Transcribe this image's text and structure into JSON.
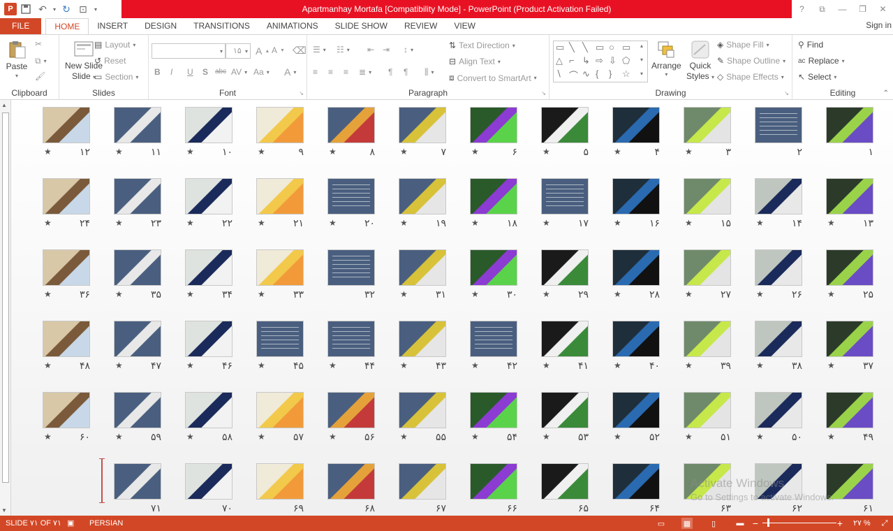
{
  "window": {
    "title": "Apartmanhay Mortafa [Compatibility Mode] -  PowerPoint (Product Activation Failed)",
    "app_icon": "P",
    "controls": [
      "?",
      "⧉",
      "—",
      "❐",
      "✕"
    ]
  },
  "qat": {
    "save_icon": "save-icon",
    "undo_icon": "undo-icon",
    "redo_icon": "redo-icon",
    "present_icon": "slideshow-icon"
  },
  "tabs": [
    "FILE",
    "HOME",
    "INSERT",
    "DESIGN",
    "TRANSITIONS",
    "ANIMATIONS",
    "SLIDE SHOW",
    "REVIEW",
    "VIEW"
  ],
  "active_tab": "HOME",
  "signin": "Sign in",
  "ribbon": {
    "clipboard": {
      "label": "Clipboard",
      "paste": "Paste"
    },
    "slides": {
      "label": "Slides",
      "new_slide": "New Slide",
      "new_slide_l2": "Slide",
      "layout": "Layout",
      "reset": "Reset",
      "section": "Section"
    },
    "font": {
      "label": "Font",
      "font_name": "",
      "font_size": "۱۵",
      "bold": "B",
      "italic": "I",
      "underline": "U",
      "shadow": "S",
      "strike": "abc",
      "spacing": "AV",
      "case": "Aa",
      "color": "A"
    },
    "paragraph": {
      "label": "Paragraph",
      "text_direction": "Text Direction",
      "align_text": "Align Text",
      "smartart": "Convert to SmartArt"
    },
    "drawing": {
      "label": "Drawing",
      "arrange": "Arrange",
      "quick": "Quick",
      "styles": "Styles",
      "shape_fill": "Shape Fill",
      "shape_outline": "Shape Outline",
      "shape_effects": "Shape Effects"
    },
    "editing": {
      "label": "Editing",
      "find": "Find",
      "replace": "Replace",
      "select": "Select"
    }
  },
  "slides": [
    {
      "n": "۱",
      "star": false
    },
    {
      "n": "۲",
      "star": false
    },
    {
      "n": "۳",
      "star": true
    },
    {
      "n": "۴",
      "star": true
    },
    {
      "n": "۵",
      "star": true
    },
    {
      "n": "۶",
      "star": true
    },
    {
      "n": "۷",
      "star": true
    },
    {
      "n": "۸",
      "star": true
    },
    {
      "n": "۹",
      "star": true
    },
    {
      "n": "۱۰",
      "star": true
    },
    {
      "n": "۱۱",
      "star": true
    },
    {
      "n": "۱۲",
      "star": true
    },
    {
      "n": "۱۳",
      "star": true
    },
    {
      "n": "۱۴",
      "star": true
    },
    {
      "n": "۱۵",
      "star": true
    },
    {
      "n": "۱۶",
      "star": true
    },
    {
      "n": "۱۷",
      "star": true
    },
    {
      "n": "۱۸",
      "star": true
    },
    {
      "n": "۱۹",
      "star": true
    },
    {
      "n": "۲۰",
      "star": true
    },
    {
      "n": "۲۱",
      "star": true
    },
    {
      "n": "۲۲",
      "star": true
    },
    {
      "n": "۲۳",
      "star": true
    },
    {
      "n": "۲۴",
      "star": true
    },
    {
      "n": "۲۵",
      "star": true
    },
    {
      "n": "۲۶",
      "star": true
    },
    {
      "n": "۲۷",
      "star": true
    },
    {
      "n": "۲۸",
      "star": true
    },
    {
      "n": "۲۹",
      "star": true
    },
    {
      "n": "۳۰",
      "star": true
    },
    {
      "n": "۳۱",
      "star": true
    },
    {
      "n": "۳۲",
      "star": false
    },
    {
      "n": "۳۳",
      "star": true
    },
    {
      "n": "۳۴",
      "star": true
    },
    {
      "n": "۳۵",
      "star": true
    },
    {
      "n": "۳۶",
      "star": true
    },
    {
      "n": "۳۷",
      "star": true
    },
    {
      "n": "۳۸",
      "star": true
    },
    {
      "n": "۳۹",
      "star": true
    },
    {
      "n": "۴۰",
      "star": true
    },
    {
      "n": "۴۱",
      "star": true
    },
    {
      "n": "۴۲",
      "star": true
    },
    {
      "n": "۴۳",
      "star": true
    },
    {
      "n": "۴۴",
      "star": true
    },
    {
      "n": "۴۵",
      "star": true
    },
    {
      "n": "۴۶",
      "star": true
    },
    {
      "n": "۴۷",
      "star": true
    },
    {
      "n": "۴۸",
      "star": true
    },
    {
      "n": "۴۹",
      "star": true
    },
    {
      "n": "۵۰",
      "star": true
    },
    {
      "n": "۵۱",
      "star": true
    },
    {
      "n": "۵۲",
      "star": true
    },
    {
      "n": "۵۳",
      "star": true
    },
    {
      "n": "۵۴",
      "star": true
    },
    {
      "n": "۵۵",
      "star": true
    },
    {
      "n": "۵۶",
      "star": true
    },
    {
      "n": "۵۷",
      "star": true
    },
    {
      "n": "۵۸",
      "star": true
    },
    {
      "n": "۵۹",
      "star": true
    },
    {
      "n": "۶۰",
      "star": true
    },
    {
      "n": "۶۱",
      "star": false
    },
    {
      "n": "۶۲",
      "star": false
    },
    {
      "n": "۶۳",
      "star": false
    },
    {
      "n": "۶۴",
      "star": false
    },
    {
      "n": "۶۵",
      "star": false
    },
    {
      "n": "۶۶",
      "star": false
    },
    {
      "n": "۶۷",
      "star": false
    },
    {
      "n": "۶۸",
      "star": false
    },
    {
      "n": "۶۹",
      "star": false
    },
    {
      "n": "۷۰",
      "star": false
    },
    {
      "n": "۷۱",
      "star": false
    }
  ],
  "star_glyph": "★",
  "watermark": {
    "line1": "Activate Windows",
    "line2": "Go to Settings to activate Windows."
  },
  "status": {
    "slide": "SLIDE ۷۱ OF ۷۱",
    "language": "PERSIAN",
    "zoom": "۲۷ %"
  },
  "colors": {
    "accent": "#d24726",
    "title_bar": "#e81123",
    "slide_bg": "#4a5f7f"
  }
}
